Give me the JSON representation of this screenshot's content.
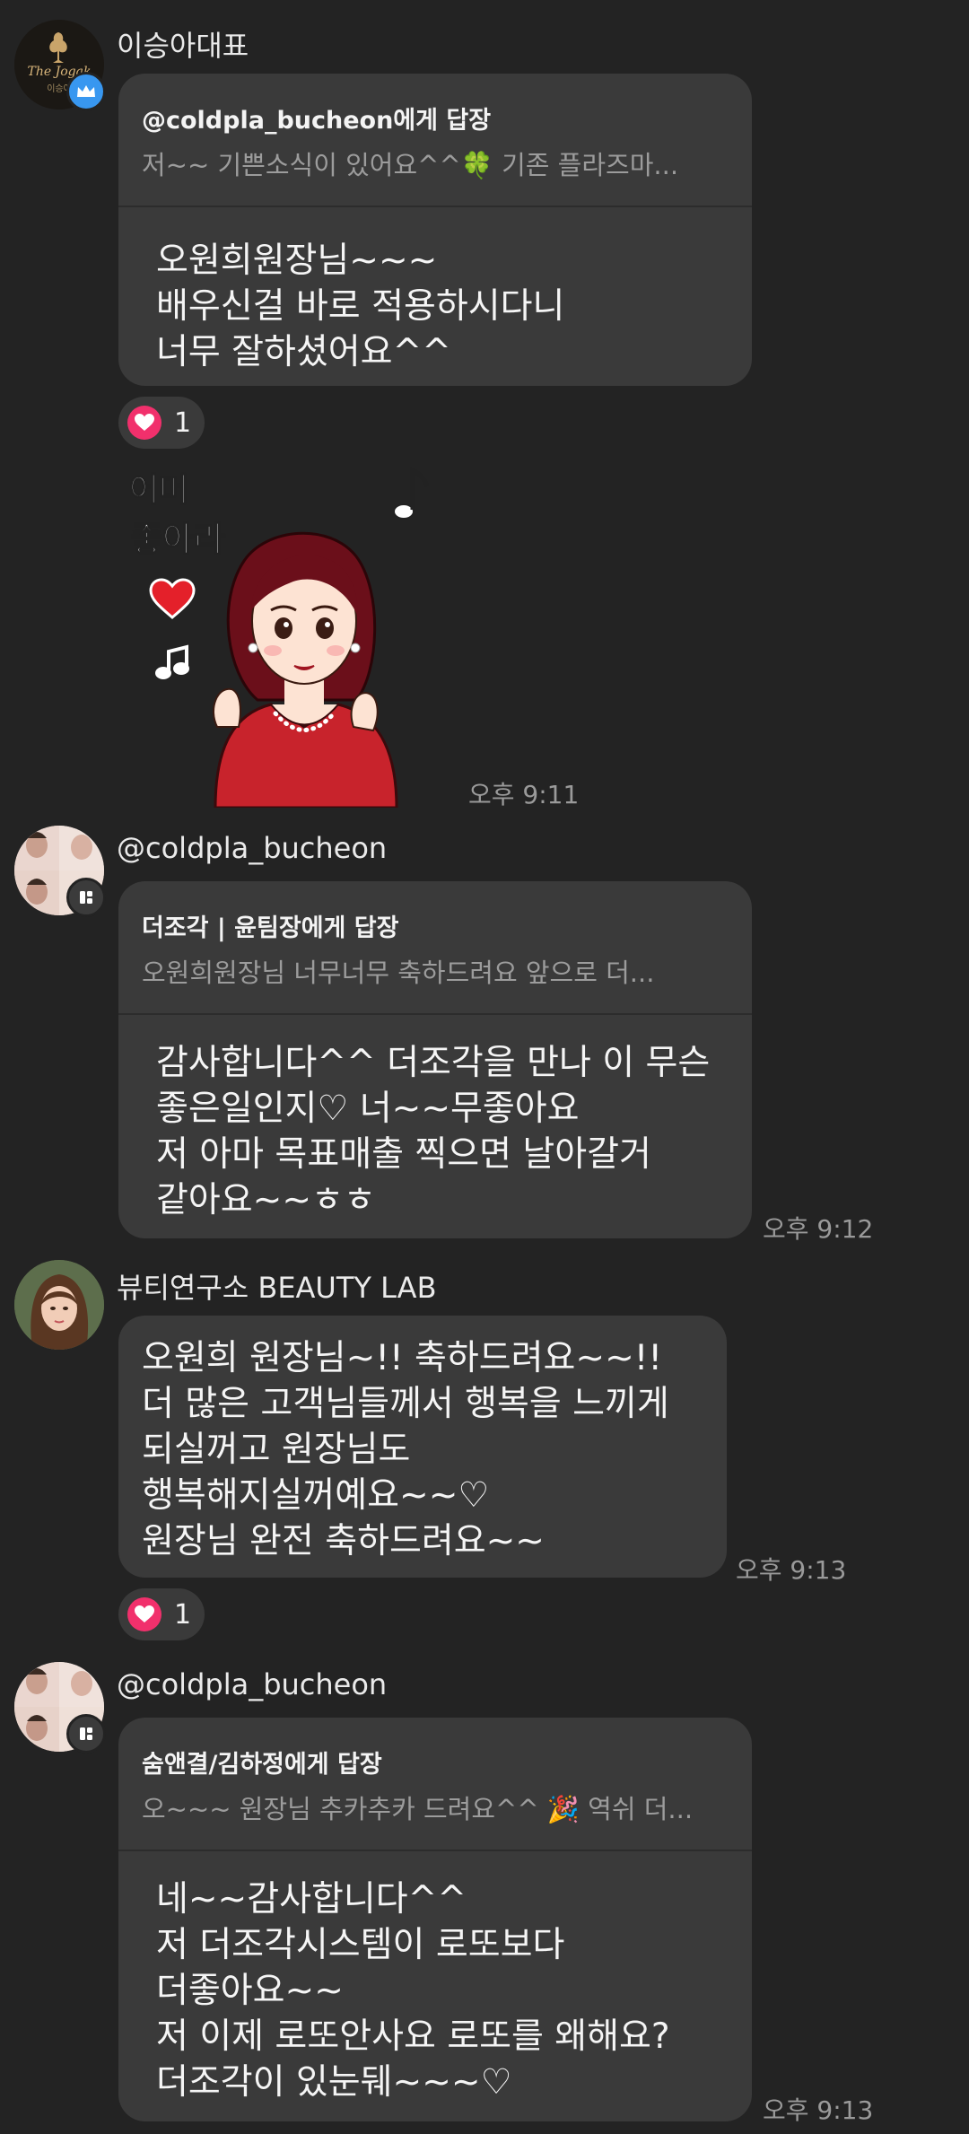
{
  "messages": [
    {
      "sender": "이승아대표",
      "quote_title": "@coldpla_bucheon에게 답장",
      "quote_text": "저~~ 기쁜소식이 있어요^^🍀 기존 플라즈마...",
      "lines": [
        "오원희원장님~~~",
        "배우신걸 바로 적용하시다니",
        "너무 잘하셨어요^^"
      ],
      "reaction_count": "1"
    },
    {
      "sticker_text_1": "어머",
      "sticker_text_2": "좋아라",
      "time": "오후 9:11"
    },
    {
      "sender": "@coldpla_bucheon",
      "quote_title": "더조각 | 윤팀장에게 답장",
      "quote_text": "오원희원장님 너무너무 축하드려요 앞으로 더...",
      "lines": [
        "감사합니다^^ 더조각을 만나 이 무슨",
        "좋은일인지♡ 너~~무좋아요",
        "저 아마 목표매출 찍으면 날아갈거",
        "같아요~~ㅎㅎ"
      ],
      "time": "오후 9:12"
    },
    {
      "sender": "뷰티연구소 BEAUTY LAB",
      "lines": [
        "오원희 원장님~!! 축하드려요~~!!",
        "더 많은 고객님들께서 행복을 느끼게",
        "되실꺼고 원장님도",
        "행복해지실꺼예요~~♡",
        "원장님 완전 축하드려요~~"
      ],
      "time": "오후 9:13",
      "reaction_count": "1"
    },
    {
      "sender": "@coldpla_bucheon",
      "quote_title": "숨앤결/김하정에게 답장",
      "quote_text": "오~~~  원장님 추카추카 드려요^^ 🎉  역쉬 더...",
      "lines": [
        "네~~감사합니다^^",
        "저 더조각시스템이 로또보다",
        "더좋아요~~",
        "저 이제 로또안사요 로또를 왜해요?",
        "더조각이 있눈뒈~~~♡"
      ],
      "time": "오후 9:13"
    }
  ],
  "avatar_logo_text": "The Jogak",
  "avatar_logo_subtext": "이승아",
  "colors": {
    "background": "#232323",
    "bubble": "#3a3a3a",
    "heart": "#f1306c",
    "crown_badge": "#3897f0"
  }
}
